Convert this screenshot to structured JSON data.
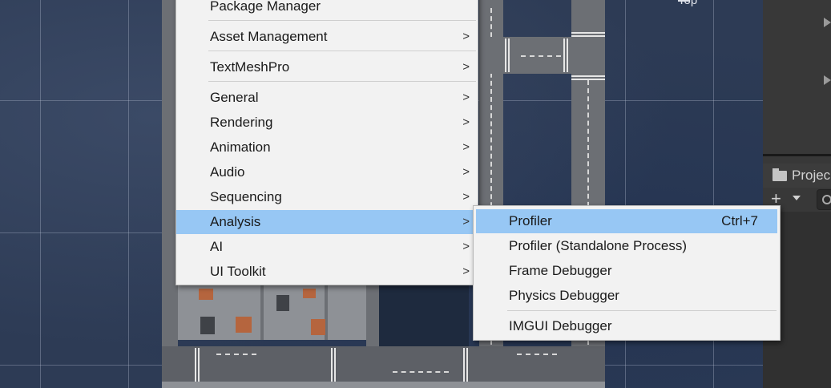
{
  "scene": {
    "view_label": "Top"
  },
  "main_menu": {
    "items": [
      {
        "label": "Package Manager",
        "submenu": false
      },
      {
        "label": "Asset Management",
        "submenu": true
      },
      {
        "label": "TextMeshPro",
        "submenu": true
      },
      {
        "label": "General",
        "submenu": true
      },
      {
        "label": "Rendering",
        "submenu": true
      },
      {
        "label": "Animation",
        "submenu": true
      },
      {
        "label": "Audio",
        "submenu": true
      },
      {
        "label": "Sequencing",
        "submenu": true
      },
      {
        "label": "Analysis",
        "submenu": true,
        "highlighted": true
      },
      {
        "label": "AI",
        "submenu": true
      },
      {
        "label": "UI Toolkit",
        "submenu": true
      }
    ],
    "arrow_glyph": ">"
  },
  "analysis_menu": {
    "items": [
      {
        "label": "Profiler",
        "shortcut": "Ctrl+7",
        "highlighted": true
      },
      {
        "label": "Profiler (Standalone Process)"
      },
      {
        "label": "Frame Debugger"
      },
      {
        "label": "Physics Debugger"
      },
      {
        "label": "IMGUI Debugger"
      }
    ]
  },
  "project_panel": {
    "tab_label": "Projec",
    "add_glyph": "+",
    "icons": [
      "folder-icon",
      "plus-icon",
      "dropdown-caret-icon",
      "search-icon",
      "play-triangle-icon"
    ]
  },
  "colors": {
    "menu_bg": "#f2f2f2",
    "menu_highlight": "#97c7f4",
    "panel_bg": "#383838",
    "scene_bg": "#2d3b55"
  }
}
